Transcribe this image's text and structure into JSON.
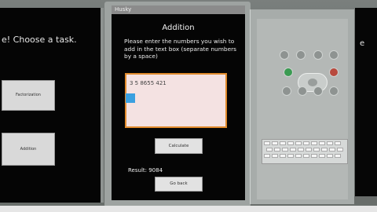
{
  "left_screen": {
    "title": "e! Choose a task.",
    "buttons": [
      "Factorization",
      "Addition"
    ]
  },
  "middle_screen": {
    "window_title": "Husky",
    "app_title": "Addition",
    "instructions": "Please enter the numbers you wish to add in the text box (separate numbers by a space)",
    "input_value": "3 5 8655 421",
    "calculate_label": "Calculate",
    "result_text": "Result: 9084",
    "back_label": "Go back"
  },
  "right_screen": {
    "partial_text": "e"
  },
  "colors": {
    "screen_bg": "#050505",
    "textbox_border": "#e08a2c",
    "cursor_handle": "#3aa0e0"
  },
  "icons": [
    "dpad-icon",
    "keyboard-icon",
    "hardware-button-icon"
  ]
}
